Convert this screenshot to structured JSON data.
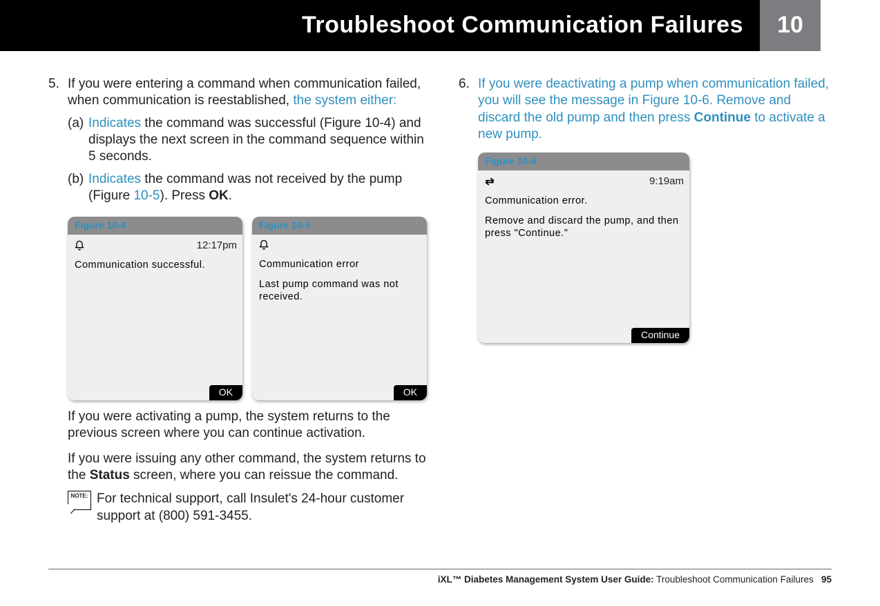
{
  "header": {
    "title": "Troubleshoot Communication Failures",
    "chapter": "10"
  },
  "left": {
    "step_num": "5.",
    "step_text_a": "If you were entering a command when communication failed, when communication is reestablished, ",
    "step_text_b": "the system either:",
    "sub_a_label": "(a)",
    "sub_a_hl": "Indicates",
    "sub_a_rest": " the command was successful (Figure 10-4) and displays the next screen in the command sequence within 5 seconds.",
    "sub_b_label": "(b)",
    "sub_b_hl": "Indicates",
    "sub_b_rest_a": " the command was not received by the pump (Figure ",
    "sub_b_rest_link": "10-5",
    "sub_b_rest_b": "). Press ",
    "sub_b_ok": "OK",
    "sub_b_rest_c": ".",
    "fig4_caption": "Figure 10-4",
    "fig4_time": "12:17pm",
    "fig4_body": "Communication successful.",
    "fig4_btn": "OK",
    "fig5_caption": "Figure 10-5",
    "fig5_l1": "Communication error",
    "fig5_l2": "Last pump command was not received.",
    "fig5_btn": "OK",
    "para1": "If you were activating a pump, the system returns to the previous screen where you can continue activation.",
    "para2a": "If you were issuing any other command, the system returns to the ",
    "para2b": "Status",
    "para2c": " screen, where you can reissue the command.",
    "note_label": "NOTE:",
    "note_text": "For technical support, call Insulet's 24-hour customer support at (800) 591-3455."
  },
  "right": {
    "step_num": "6.",
    "step_text_a": "If you were deactivating a pump when communication failed, you will see the message in Figure 10-6. Remove and discard the old pump and then press ",
    "step_text_b": "Continue",
    "step_text_c": " to activate a new pump.",
    "fig6_caption": "Figure 10-6",
    "fig6_time": "9:19am",
    "fig6_l1": "Communication error.",
    "fig6_l2": "Remove and discard the pump, and then press \"Continue.\"",
    "fig6_btn": "Continue"
  },
  "footer": {
    "bold": "iXL™ Diabetes Management System User Guide:",
    "rest": " Troubleshoot Communication Failures",
    "page": "95"
  }
}
